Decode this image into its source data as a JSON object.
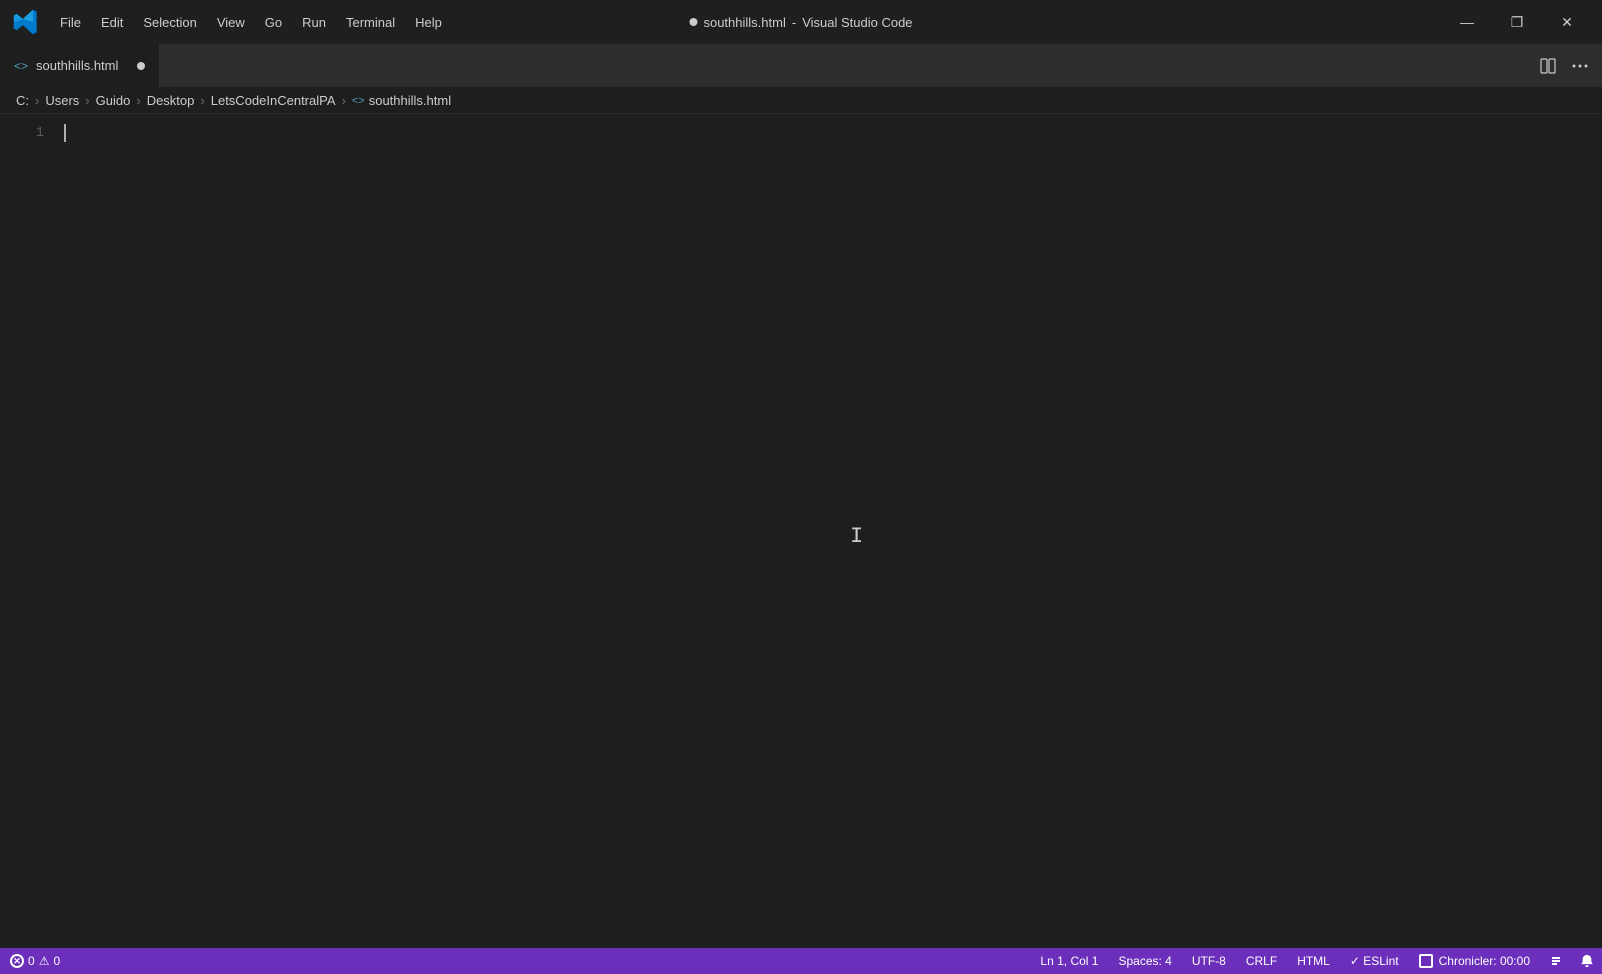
{
  "titleBar": {
    "title": "● southhills.html - Visual Studio Code",
    "fileTitle": "southhills.html",
    "dot": true,
    "appName": "Visual Studio Code",
    "menuItems": [
      "File",
      "Edit",
      "Selection",
      "View",
      "Go",
      "Run",
      "Terminal",
      "Help"
    ],
    "controls": {
      "minimize": "—",
      "maximize": "❐",
      "close": "✕"
    }
  },
  "tab": {
    "icon": "<>",
    "filename": "southhills.html",
    "modified": true
  },
  "tabActions": {
    "splitEditor": "⊟",
    "more": "···"
  },
  "breadcrumb": {
    "items": [
      "C:",
      "Users",
      "Guido",
      "Desktop",
      "LetsCodeInCentralPA",
      "southhills.html"
    ],
    "separator": "›"
  },
  "editor": {
    "lineNumbers": [
      1
    ],
    "content": ""
  },
  "statusBar": {
    "errors": "0",
    "warnings": "0",
    "position": "Ln 1, Col 1",
    "spaces": "Spaces: 4",
    "encoding": "UTF-8",
    "lineEnding": "CRLF",
    "language": "HTML",
    "eslint": "✓  ESLint",
    "chronicler": "Chronicler: 00:00",
    "remoteName": "",
    "notifications": ""
  }
}
